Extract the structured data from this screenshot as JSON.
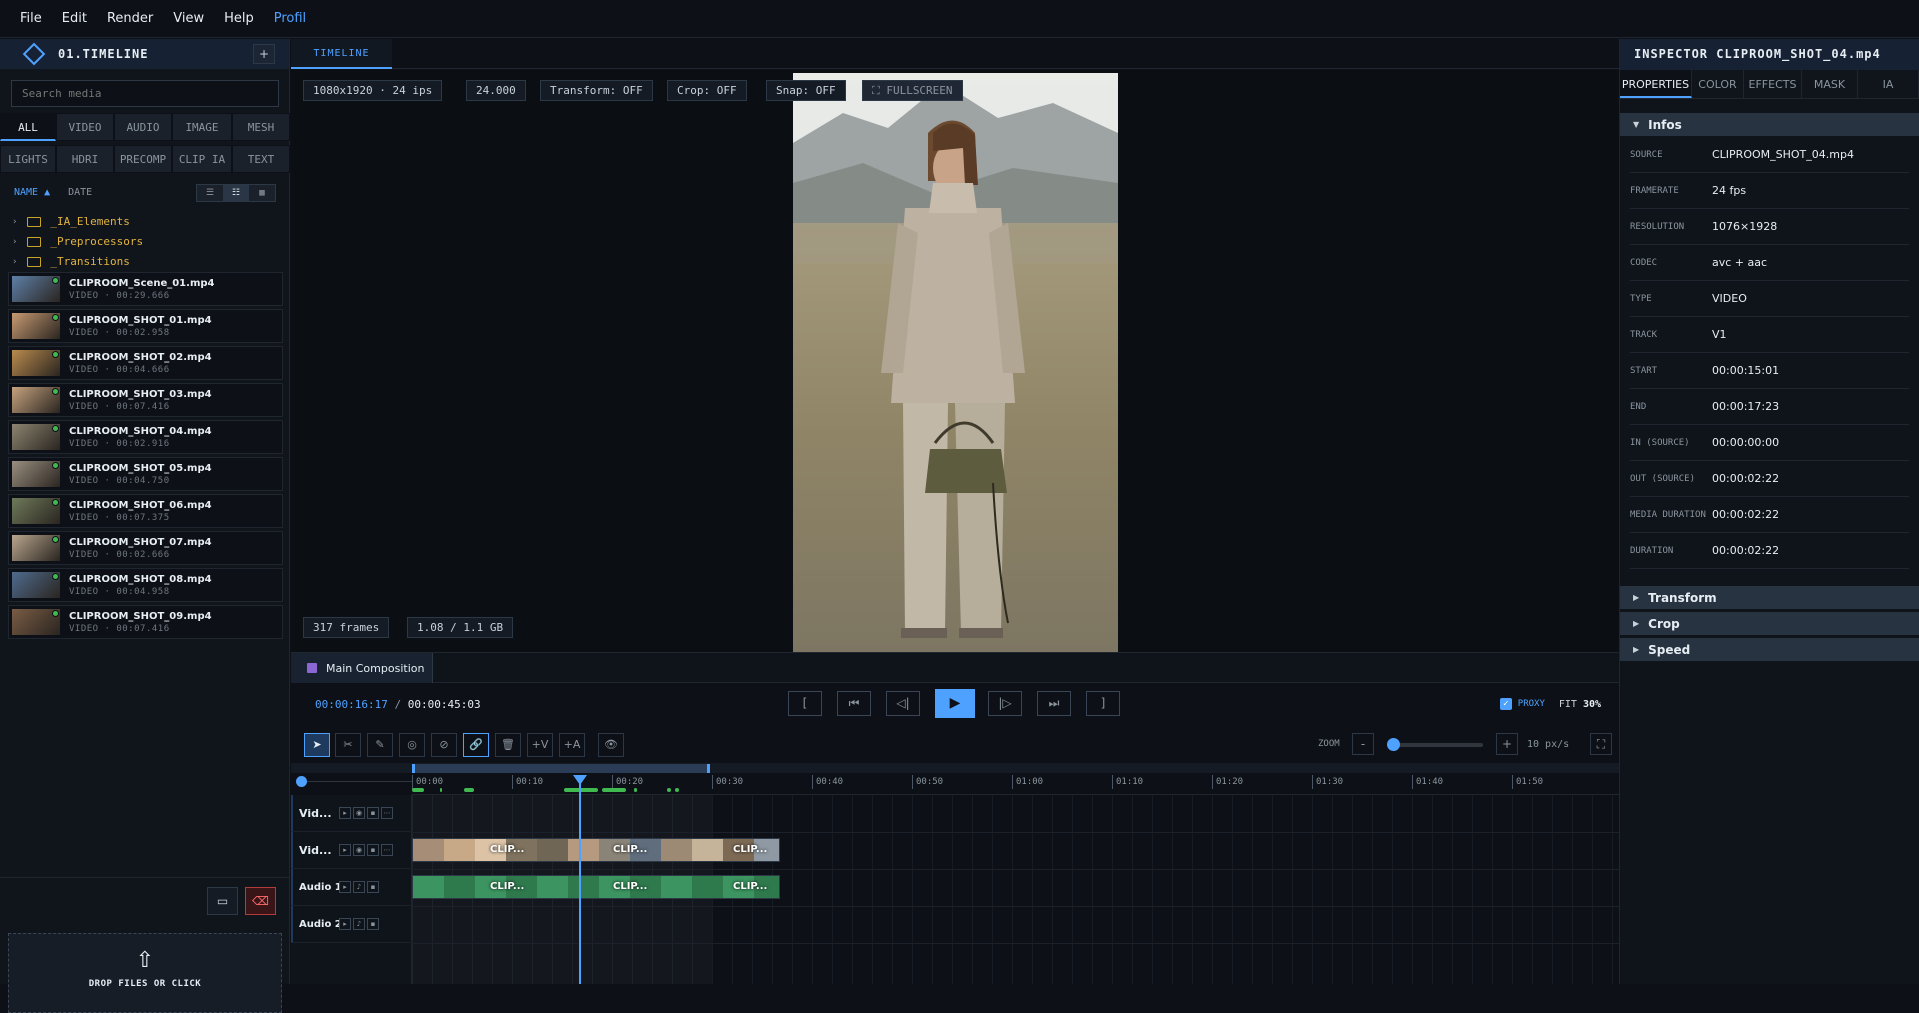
{
  "menu": [
    "File",
    "Edit",
    "Render",
    "View",
    "Help",
    "Profil"
  ],
  "left": {
    "title": "01.TIMELINE",
    "add_label": "+",
    "search_placeholder": "Search media",
    "filters_row1": [
      "ALL",
      "VIDEO",
      "AUDIO",
      "IMAGE",
      "MESH"
    ],
    "filters_row2": [
      "LIGHTS",
      "HDRI",
      "PRECOMP",
      "CLIP IA",
      "TEXT"
    ],
    "sort_name": "NAME ▲",
    "sort_date": "DATE",
    "folders": [
      "_IA_Elements",
      "_Preprocessors",
      "_Transitions"
    ],
    "media": [
      {
        "name": "CLIPROOM_Scene_01.mp4",
        "meta": "VIDEO · 00:29.666",
        "color": "#5e7fa8"
      },
      {
        "name": "CLIPROOM_SHOT_01.mp4",
        "meta": "VIDEO · 00:02.958",
        "color": "#c79a72"
      },
      {
        "name": "CLIPROOM_SHOT_02.mp4",
        "meta": "VIDEO · 00:04.666",
        "color": "#b98a4e"
      },
      {
        "name": "CLIPROOM_SHOT_03.mp4",
        "meta": "VIDEO · 00:07.416",
        "color": "#c6a27e"
      },
      {
        "name": "CLIPROOM_SHOT_04.mp4",
        "meta": "VIDEO · 00:02.916",
        "color": "#8c8470"
      },
      {
        "name": "CLIPROOM_SHOT_05.mp4",
        "meta": "VIDEO · 00:04.750",
        "color": "#9a8f80"
      },
      {
        "name": "CLIPROOM_SHOT_06.mp4",
        "meta": "VIDEO · 00:07.375",
        "color": "#6e7a5a"
      },
      {
        "name": "CLIPROOM_SHOT_07.mp4",
        "meta": "VIDEO · 00:02.666",
        "color": "#b8a58e"
      },
      {
        "name": "CLIPROOM_SHOT_08.mp4",
        "meta": "VIDEO · 00:04.958",
        "color": "#4f6b8e"
      },
      {
        "name": "CLIPROOM_SHOT_09.mp4",
        "meta": "VIDEO · 00:07.416",
        "color": "#7a5c45"
      }
    ],
    "drop_arrow": "⇧",
    "drop_text": "DROP FILES OR CLICK"
  },
  "viewer": {
    "tab": "TIMELINE",
    "chips": [
      "1080x1920 · 24 ips",
      "24.000",
      "Transform: OFF",
      "Crop: OFF",
      "Snap: OFF",
      "⛶ FULLSCREEN"
    ],
    "frames": "317 frames",
    "memory": "1.08 / 1.1 GB"
  },
  "composition": {
    "tab": "Main Composition",
    "timecode_current": "00:00:16:17",
    "timecode_sep": " / ",
    "timecode_total": "00:00:45:03",
    "proxy_label": "PROXY",
    "fit_label": "FIT",
    "fit_value": "30%",
    "zoom_label": "ZOOM",
    "zoom_minus": "-",
    "zoom_plus": "+",
    "zoom_value": "10 px/s",
    "zoom_level": 0.02,
    "ruler": [
      "00:00",
      "00:10",
      "00:20",
      "00:30",
      "00:40",
      "00:50",
      "01:00",
      "01:10",
      "01:20",
      "01:30",
      "01:40",
      "01:50"
    ],
    "tracks": [
      "Vid...",
      "Vid...",
      "Audio 1",
      "Audio 2"
    ],
    "clip_label": "CLIP..."
  },
  "inspector": {
    "title": "INSPECTOR  CLIPROOM_SHOT_04.mp4",
    "tabs": [
      "PROPERTIES",
      "COLOR",
      "EFFECTS",
      "MASK",
      "IA"
    ],
    "section_infos": "Infos",
    "props": [
      {
        "k": "SOURCE",
        "v": "CLIPROOM_SHOT_04.mp4"
      },
      {
        "k": "FRAMERATE",
        "v": "24 fps"
      },
      {
        "k": "RESOLUTION",
        "v": "1076×1928"
      },
      {
        "k": "CODEC",
        "v": "avc + aac"
      },
      {
        "k": "TYPE",
        "v": "VIDEO"
      },
      {
        "k": "TRACK",
        "v": "V1"
      },
      {
        "k": "START",
        "v": "00:00:15:01"
      },
      {
        "k": "END",
        "v": "00:00:17:23"
      },
      {
        "k": "IN (SOURCE)",
        "v": "00:00:00:00"
      },
      {
        "k": "OUT (SOURCE)",
        "v": "00:00:02:22"
      },
      {
        "k": "MEDIA DURATION",
        "v": "00:00:02:22"
      },
      {
        "k": "DURATION",
        "v": "00:00:02:22"
      }
    ],
    "sections": [
      "Transform",
      "Crop",
      "Speed"
    ]
  }
}
